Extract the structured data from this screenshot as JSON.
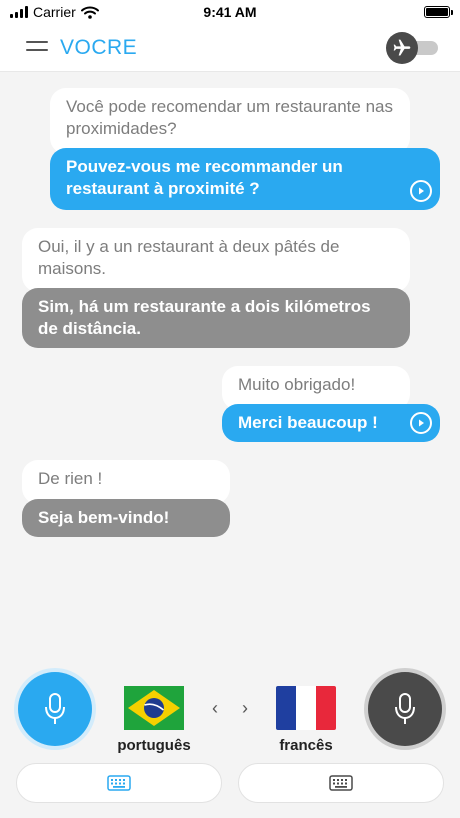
{
  "status_bar": {
    "carrier": "Carrier",
    "time": "9:41 AM"
  },
  "header": {
    "logo": "VOCRE",
    "icons": {
      "menu": "hamburger-menu-icon",
      "flight_mode": "airplane-icon"
    },
    "flight_mode_on": false
  },
  "conversation": [
    {
      "side": "right",
      "source_text": "Você pode recomendar um restaurante nas proximidades?",
      "translation_text": "Pouvez-vous me recommander un restaurant à proximité ?",
      "translation_color": "#2aa9f0"
    },
    {
      "side": "left",
      "source_text": "Oui, il y a un restaurant à deux pâtés de maisons.",
      "translation_text": "Sim, há um restaurante a dois kilómetros de distância.",
      "translation_color": "#8e8e8e"
    },
    {
      "side": "right",
      "source_text": "Muito obrigado!",
      "translation_text": "Merci beaucoup !",
      "translation_color": "#2aa9f0"
    },
    {
      "side": "left",
      "source_text": "De rien !",
      "translation_text": "Seja bem-vindo!",
      "translation_color": "#8e8e8e"
    }
  ],
  "controls": {
    "left_language": "português",
    "right_language": "francês",
    "swap_left": "‹",
    "swap_right": "›",
    "left_mic_color": "#2aa9f0",
    "right_mic_color": "#4a4a4a",
    "icons": {
      "mic": "microphone-icon",
      "keyboard": "keyboard-icon",
      "play": "play-icon"
    }
  },
  "colors": {
    "accent": "#2aa9f0",
    "dark": "#4a4a4a",
    "bubble_gray": "#8e8e8e",
    "background": "#f4f4f4"
  }
}
